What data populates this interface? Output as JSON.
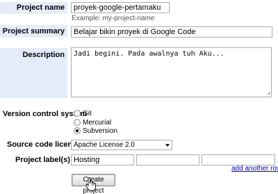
{
  "form": {
    "project_name": {
      "label": "Project name",
      "value": "proyek-google-pertamaku",
      "hint": "Example: my-project-name"
    },
    "project_summary": {
      "label": "Project summary",
      "value": "Belajar bikin proyek di Google Code"
    },
    "description": {
      "label": "Description",
      "value": "Jadi begini. Pada awalnya tuh Aku..."
    },
    "vcs": {
      "label": "Version control system",
      "options": [
        "Git",
        "Mercurial",
        "Subversion"
      ],
      "selected": "Subversion"
    },
    "license": {
      "label": "Source code license",
      "value": "Apache License 2.0"
    },
    "labels": {
      "label": "Project label(s)",
      "values": [
        "Hosting",
        "",
        ""
      ],
      "add_row_link": "add another row"
    },
    "submit_label": "Create project"
  },
  "colors": {
    "label_bg": "#e5ecf9",
    "link": "#0000cc"
  }
}
